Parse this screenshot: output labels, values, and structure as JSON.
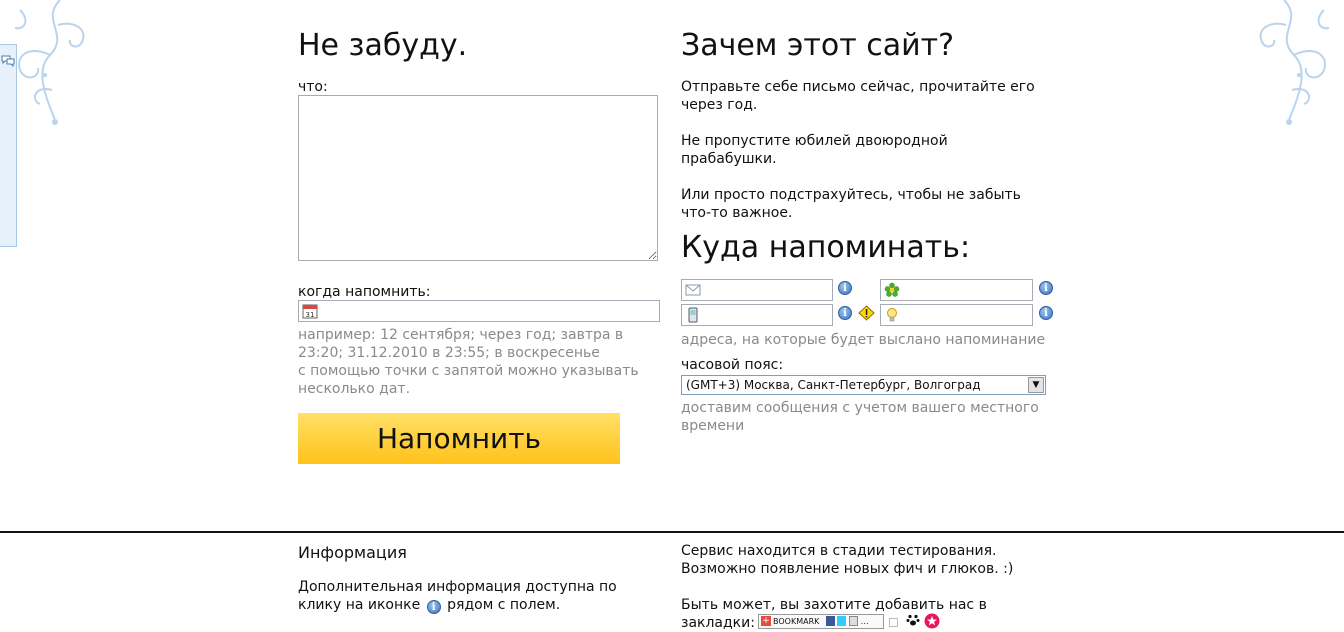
{
  "form": {
    "title": "Не забуду.",
    "what_label": "что:",
    "what_value": "",
    "when_label": "когда напомнить:",
    "when_value": "",
    "calendar_day": "31",
    "hint_line1": "например: 12 сентября; через год; завтра в 23:20; 31.12.2010 в 23:55; в воскресенье",
    "hint_line2": "с помощью точки с запятой можно указывать несколько дат.",
    "submit_label": "Напомнить"
  },
  "why": {
    "title": "Зачем этот сайт?",
    "p1": "Отправьте себе письмо сейчас, прочитайте его через год.",
    "p2": "Не пропустите юбилей двоюродной прабабушки.",
    "p3": "Или просто подстрахуйтесь, чтобы не забыть что-то важное."
  },
  "where": {
    "title": "Куда напоминать:",
    "fields": [
      {
        "icon": "envelope-icon",
        "value": ""
      },
      {
        "icon": "icq-flower-icon",
        "value": ""
      },
      {
        "icon": "mobile-phone-icon",
        "value": ""
      },
      {
        "icon": "lightbulb-icon",
        "value": ""
      }
    ],
    "info_glyph": "i",
    "addresses_hint": "адреса, на которые будет выслано напоминание",
    "timezone_label": "часовой пояс:",
    "timezone_value": "(GMT+3) Москва, Санкт-Петербург, Волгоград",
    "timezone_hint": "доставим сообщения с учетом вашего местного времени"
  },
  "footer": {
    "info_title": "Информация",
    "info_text_before": "Дополнительная информация доступна по клику на иконке",
    "info_text_after": "рядом с полем.",
    "status_text": "Сервис находится в стадии тестирования. Возможно появление новых фич и глюков. :)",
    "bookmark_text": "Быть может, вы захотите добавить нас в закладки:",
    "bookmark_button_label": "BOOKMARK"
  },
  "colors": {
    "hint_gray": "#8a8a8a",
    "button_yellow_top": "#ffe066",
    "button_yellow_bottom": "#ffc21a",
    "info_blue": "#3a74c2",
    "ornament_blue": "#b9d4ee"
  }
}
